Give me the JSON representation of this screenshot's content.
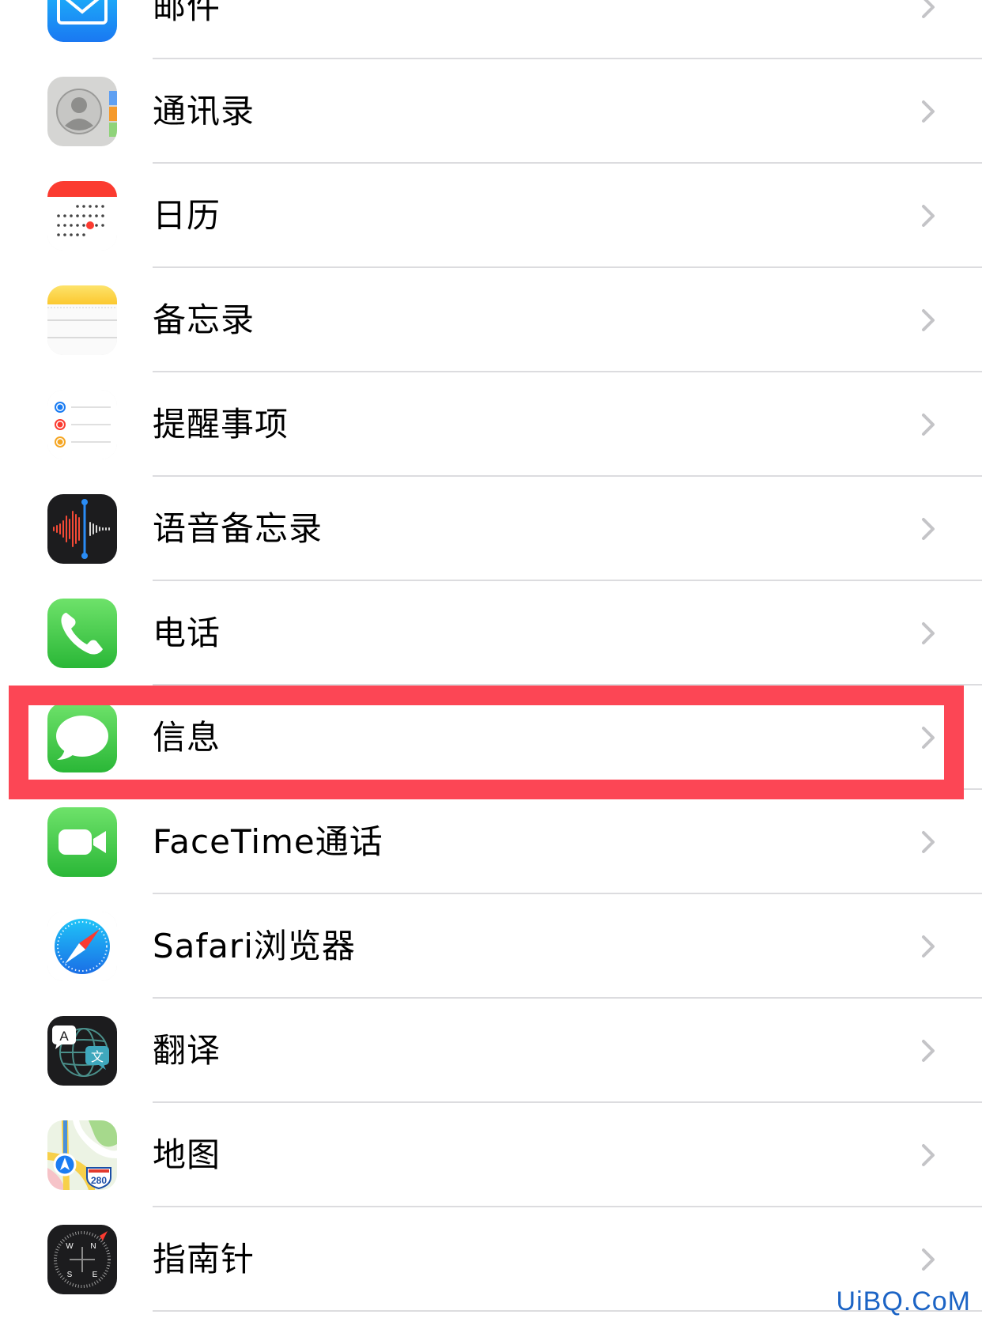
{
  "settings_list": {
    "items": [
      {
        "id": "mail",
        "label": "邮件",
        "icon": "mail-icon"
      },
      {
        "id": "contacts",
        "label": "通讯录",
        "icon": "contacts-icon"
      },
      {
        "id": "calendar",
        "label": "日历",
        "icon": "calendar-icon"
      },
      {
        "id": "notes",
        "label": "备忘录",
        "icon": "notes-icon"
      },
      {
        "id": "reminders",
        "label": "提醒事项",
        "icon": "reminders-icon"
      },
      {
        "id": "voice-memos",
        "label": "语音备忘录",
        "icon": "voice-memos-icon"
      },
      {
        "id": "phone",
        "label": "电话",
        "icon": "phone-icon"
      },
      {
        "id": "messages",
        "label": "信息",
        "icon": "messages-icon",
        "highlighted": true
      },
      {
        "id": "facetime",
        "label": "FaceTime通话",
        "icon": "facetime-icon"
      },
      {
        "id": "safari",
        "label": "Safari浏览器",
        "icon": "safari-icon"
      },
      {
        "id": "translate",
        "label": "翻译",
        "icon": "translate-icon"
      },
      {
        "id": "maps",
        "label": "地图",
        "icon": "maps-icon"
      },
      {
        "id": "compass",
        "label": "指南针",
        "icon": "compass-icon"
      }
    ],
    "icon_text": {
      "translate_a": "A",
      "translate_zh": "文",
      "maps_shield": "280",
      "compass_n": "N",
      "compass_e": "E",
      "compass_s": "S",
      "compass_w": "W"
    }
  },
  "highlight_color": "#fc4655",
  "watermark": "UiBQ.CoM"
}
